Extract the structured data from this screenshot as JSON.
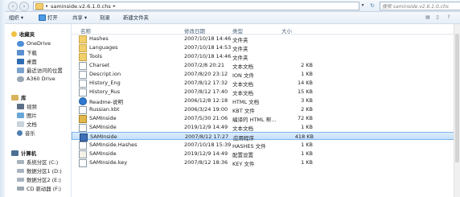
{
  "window": {
    "path_crumbs": [
      "saminside.v2.6.1.0.chs"
    ],
    "search_placeholder": "搜索 saminside.v2.6.1.0.chs"
  },
  "toolbar": {
    "organize": "组织 ▾",
    "open": "打开",
    "share": "共享 ▾",
    "burn": "刻录",
    "new_folder": "新建文件夹"
  },
  "sidebar": {
    "items": [
      {
        "label": "收藏夹",
        "icon": "star-icon",
        "header": true
      },
      {
        "label": "OneDrive",
        "icon": "cloud-icon"
      },
      {
        "label": "下载",
        "icon": "download-folder-icon"
      },
      {
        "label": "桌面",
        "icon": "desktop-icon"
      },
      {
        "label": "最近访问的位置",
        "icon": "recent-places-icon"
      },
      {
        "label": "A360 Drive",
        "icon": "cloud-drive-icon"
      },
      {
        "label": "库",
        "icon": "library-icon",
        "header": true
      },
      {
        "label": "视频",
        "icon": "video-icon"
      },
      {
        "label": "图片",
        "icon": "picture-icon"
      },
      {
        "label": "文档",
        "icon": "document-icon"
      },
      {
        "label": "音乐",
        "icon": "music-icon"
      },
      {
        "label": "计算机",
        "icon": "computer-icon",
        "header": true
      },
      {
        "label": "系统分区 (C:)",
        "icon": "drive-icon"
      },
      {
        "label": "数据分区1 (D:)",
        "icon": "drive-icon"
      },
      {
        "label": "数据分区2 (E:)",
        "icon": "drive-icon"
      },
      {
        "label": "CD 驱动器 (F:)",
        "icon": "cd-drive-icon"
      }
    ]
  },
  "columns": {
    "name": "名称",
    "date": "修改日期",
    "type": "类型",
    "size": "大小"
  },
  "files": [
    {
      "name": "Hashes",
      "date": "2007/10/18 14:46",
      "type": "文件夹",
      "size": "",
      "icon": "folder-icon"
    },
    {
      "name": "Languages",
      "date": "2007/10/18 14:53",
      "type": "文件夹",
      "size": "",
      "icon": "folder-icon"
    },
    {
      "name": "Tools",
      "date": "2007/10/18 14:46",
      "type": "文件夹",
      "size": "",
      "icon": "folder-icon"
    },
    {
      "name": "Charset",
      "date": "2007/2/8 20:21",
      "type": "文本文档",
      "size": "2 KB",
      "icon": "text-file-icon"
    },
    {
      "name": "Descript.ion",
      "date": "2007/8/20 23:12",
      "type": "ION 文件",
      "size": "1 KB",
      "icon": "generic-file-icon"
    },
    {
      "name": "History_Eng",
      "date": "2007/8/12 17:32",
      "type": "文本文档",
      "size": "14 KB",
      "icon": "text-file-icon"
    },
    {
      "name": "History_Rus",
      "date": "2007/8/12 17:40",
      "type": "文本文档",
      "size": "15 KB",
      "icon": "text-file-icon"
    },
    {
      "name": "Readme-说明",
      "date": "2006/12/8 12:18",
      "type": "HTML 文档",
      "size": "3 KB",
      "icon": "html-file-icon"
    },
    {
      "name": "Russian.kbt",
      "date": "2006/3/24 19:00",
      "type": "KBT 文件",
      "size": "2 KB",
      "icon": "generic-file-icon"
    },
    {
      "name": "SAMInside",
      "date": "2007/5/30 21:06",
      "type": "编译的 HTML 帮...",
      "size": "72 KB",
      "icon": "chm-file-icon"
    },
    {
      "name": "SAMInside",
      "date": "2019/12/9 14:49",
      "type": "文本文档",
      "size": "1 KB",
      "icon": "text-file-icon"
    },
    {
      "name": "SAMInside",
      "date": "2007/8/12 17:27",
      "type": "应用程序",
      "size": "418 KB",
      "icon": "app-icon",
      "selected": true
    },
    {
      "name": "SAMInside.Hashes",
      "date": "2007/10/18 15:39",
      "type": "HASHES 文件",
      "size": "1 KB",
      "icon": "generic-file-icon"
    },
    {
      "name": "SAMInside",
      "date": "2019/12/9 14:49",
      "type": "配置设置",
      "size": "1 KB",
      "icon": "config-file-icon"
    },
    {
      "name": "SAMInside.key",
      "date": "2007/8/12 18:36",
      "type": "KEY 文件",
      "size": "1 KB",
      "icon": "generic-file-icon"
    }
  ]
}
